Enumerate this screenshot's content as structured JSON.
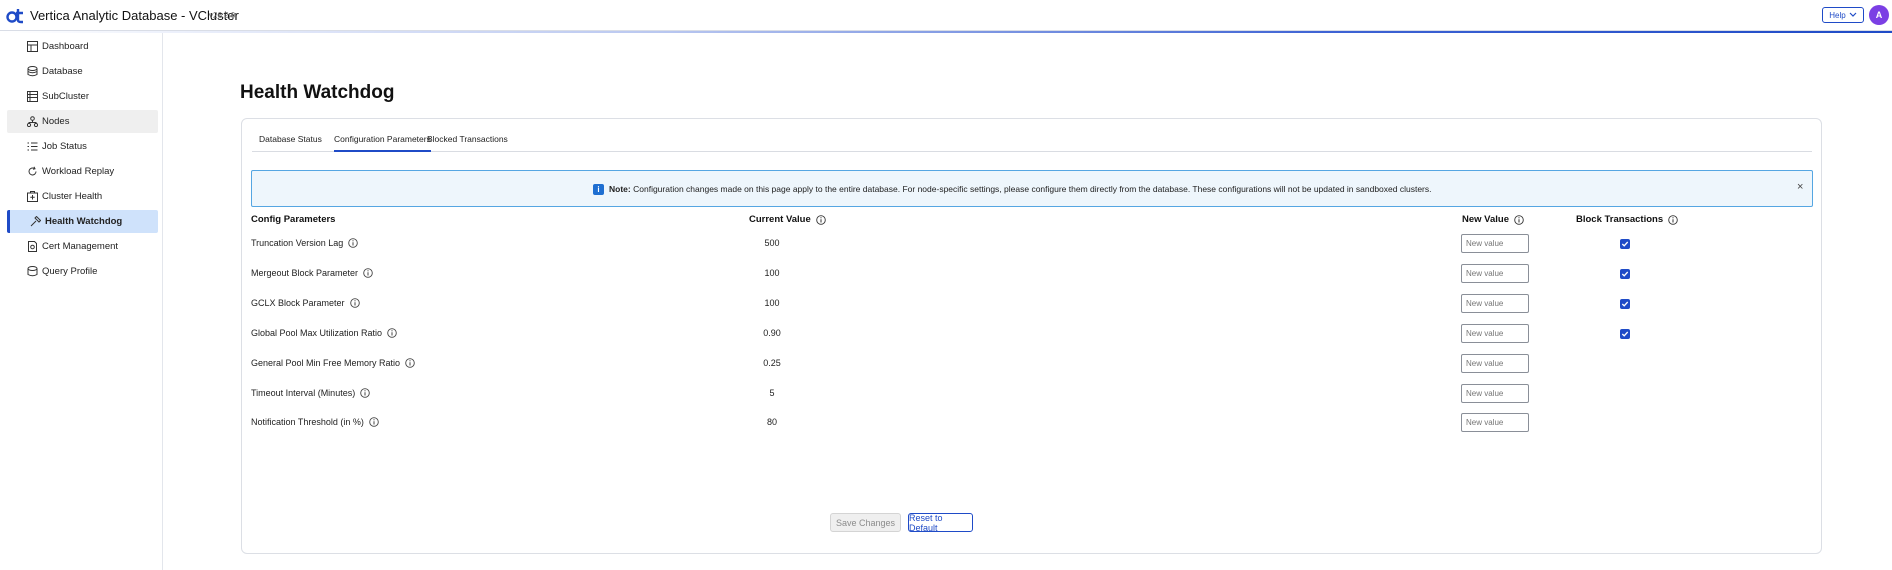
{
  "header": {
    "title": "Vertica Analytic Database - VCluster",
    "version": "v26.2.0",
    "help_label": "Help",
    "avatar_initial": "A"
  },
  "sidebar": {
    "items": [
      {
        "label": "Dashboard",
        "icon": "dashboard-icon"
      },
      {
        "label": "Database",
        "icon": "database-icon"
      },
      {
        "label": "SubCluster",
        "icon": "subcluster-icon"
      },
      {
        "label": "Nodes",
        "icon": "nodes-icon"
      },
      {
        "label": "Job Status",
        "icon": "job-status-icon"
      },
      {
        "label": "Workload Replay",
        "icon": "replay-icon"
      },
      {
        "label": "Cluster Health",
        "icon": "cluster-health-icon"
      },
      {
        "label": "Health Watchdog",
        "icon": "watchdog-icon"
      },
      {
        "label": "Cert Management",
        "icon": "certificate-icon"
      },
      {
        "label": "Query Profile",
        "icon": "query-profile-icon"
      }
    ],
    "active": "Health Watchdog",
    "hovered": "Nodes"
  },
  "main": {
    "title": "Health Watchdog",
    "tabs": [
      {
        "label": "Database Status"
      },
      {
        "label": "Configuration Parameters"
      },
      {
        "label": "Blocked Transactions"
      }
    ],
    "active_tab": "Configuration Parameters",
    "note": {
      "prefix": "Note:",
      "text": "Configuration changes made on this page apply to the entire database. For node-specific settings, please configure them directly from the database. These configurations will not be updated in sandboxed clusters."
    },
    "table": {
      "headers": {
        "param": "Config Parameters",
        "current": "Current Value",
        "new": "New Value",
        "block": "Block Transactions"
      },
      "rows": [
        {
          "name": "Truncation Version Lag",
          "current": "500",
          "placeholder": "New value",
          "block": true
        },
        {
          "name": "Mergeout Block Parameter",
          "current": "100",
          "placeholder": "New value",
          "block": true
        },
        {
          "name": "GCLX Block Parameter",
          "current": "100",
          "placeholder": "New value",
          "block": true
        },
        {
          "name": "Global Pool Max Utilization Ratio",
          "current": "0.90",
          "placeholder": "New value",
          "block": true
        },
        {
          "name": "General Pool Min Free Memory Ratio",
          "current": "0.25",
          "placeholder": "New value",
          "block": false
        },
        {
          "name": "Timeout Interval (Minutes)",
          "current": "5",
          "placeholder": "New value",
          "block": false
        },
        {
          "name": "Notification Threshold (in %)",
          "current": "80",
          "placeholder": "New value",
          "block": false
        }
      ]
    },
    "buttons": {
      "save": "Save Changes",
      "reset": "Reset to Default"
    }
  },
  "colors": {
    "accent": "#1f4bc7",
    "active_nav_bg": "#cfe2fb",
    "note_bg": "#eef6fc",
    "note_border": "#55a6e2",
    "avatar": "#7b3fe4"
  }
}
